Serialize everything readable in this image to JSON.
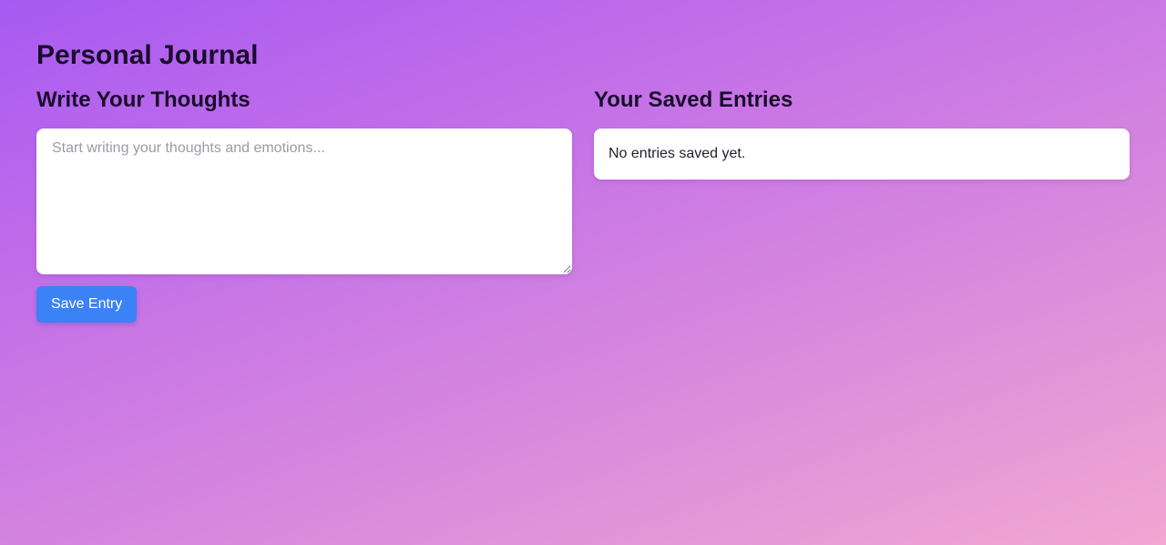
{
  "page": {
    "title": "Personal Journal"
  },
  "editor": {
    "heading": "Write Your Thoughts",
    "placeholder": "Start writing your thoughts and emotions...",
    "value": "",
    "save_label": "Save Entry"
  },
  "entries": {
    "heading": "Your Saved Entries",
    "empty_message": "No entries saved yet.",
    "items": []
  },
  "colors": {
    "background_start": "#a85af2",
    "background_end": "#f3a6d2",
    "accent_button": "#3b82f6",
    "card": "#ffffff"
  }
}
